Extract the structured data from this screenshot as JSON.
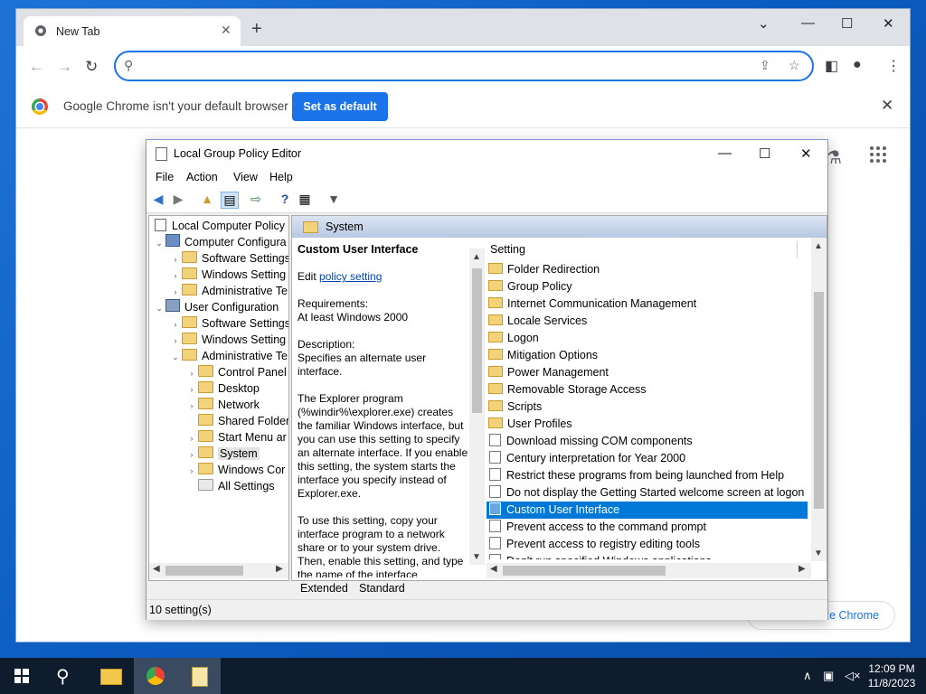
{
  "chrome": {
    "tab_title": "New Tab",
    "tab_close": "✕",
    "new_tab": "+",
    "minimize": "⌄",
    "maximize": "☐",
    "close": "✕",
    "omnibox_value": "",
    "infobar_message": "Google Chrome isn't your default browser",
    "infobar_button": "Set as default",
    "infobar_close": "✕",
    "customize_label": "Customize Chrome"
  },
  "gpe": {
    "title": "Local Group Policy Editor",
    "menu": [
      "File",
      "Action",
      "View",
      "Help"
    ],
    "tree": [
      {
        "label": "Local Computer Policy"
      },
      {
        "label": "Computer Configura"
      },
      {
        "label": "Software Settings"
      },
      {
        "label": "Windows Setting"
      },
      {
        "label": "Administrative Te"
      },
      {
        "label": "User Configuration"
      },
      {
        "label": "Software Settings"
      },
      {
        "label": "Windows Setting"
      },
      {
        "label": "Administrative Te"
      },
      {
        "label": "Control Panel"
      },
      {
        "label": "Desktop"
      },
      {
        "label": "Network"
      },
      {
        "label": "Shared Folder"
      },
      {
        "label": "Start Menu ar"
      },
      {
        "label": "System"
      },
      {
        "label": "Windows Cor"
      },
      {
        "label": "All Settings"
      }
    ],
    "header_folder": "System",
    "desc": {
      "title": "Custom User Interface",
      "edit_prefix": "Edit ",
      "edit_link": "policy setting",
      "req_label": "Requirements:",
      "req_value": "At least Windows 2000",
      "desc_label": "Description:",
      "desc_value": "Specifies an alternate user interface.",
      "para1": "The Explorer program (%windir%\\explorer.exe) creates the familiar Windows interface, but you can use this setting to specify an alternate interface. If you enable this setting, the system starts the interface you specify instead of Explorer.exe.",
      "para2": "To use this setting, copy your interface program to a network share or to your system drive. Then, enable this setting, and type the name of the interface"
    },
    "column_header": "Setting",
    "settings": [
      {
        "label": "Folder Redirection",
        "kind": "folder"
      },
      {
        "label": "Group Policy",
        "kind": "folder"
      },
      {
        "label": "Internet Communication Management",
        "kind": "folder"
      },
      {
        "label": "Locale Services",
        "kind": "folder"
      },
      {
        "label": "Logon",
        "kind": "folder"
      },
      {
        "label": "Mitigation Options",
        "kind": "folder"
      },
      {
        "label": "Power Management",
        "kind": "folder"
      },
      {
        "label": "Removable Storage Access",
        "kind": "folder"
      },
      {
        "label": "Scripts",
        "kind": "folder"
      },
      {
        "label": "User Profiles",
        "kind": "folder"
      },
      {
        "label": "Download missing COM components",
        "kind": "policy"
      },
      {
        "label": "Century interpretation for Year 2000",
        "kind": "policy"
      },
      {
        "label": "Restrict these programs from being launched from Help",
        "kind": "policy"
      },
      {
        "label": "Do not display the Getting Started welcome screen at logon",
        "kind": "policy"
      },
      {
        "label": "Custom User Interface",
        "kind": "policy",
        "selected": true
      },
      {
        "label": "Prevent access to the command prompt",
        "kind": "policy"
      },
      {
        "label": "Prevent access to registry editing tools",
        "kind": "policy"
      },
      {
        "label": "Don't run specified Windows applications",
        "kind": "policy"
      }
    ],
    "tab_extended": "Extended",
    "tab_standard": "Standard",
    "status": "10 setting(s)"
  },
  "taskbar": {
    "time": "12:09 PM",
    "date": "11/8/2023"
  }
}
